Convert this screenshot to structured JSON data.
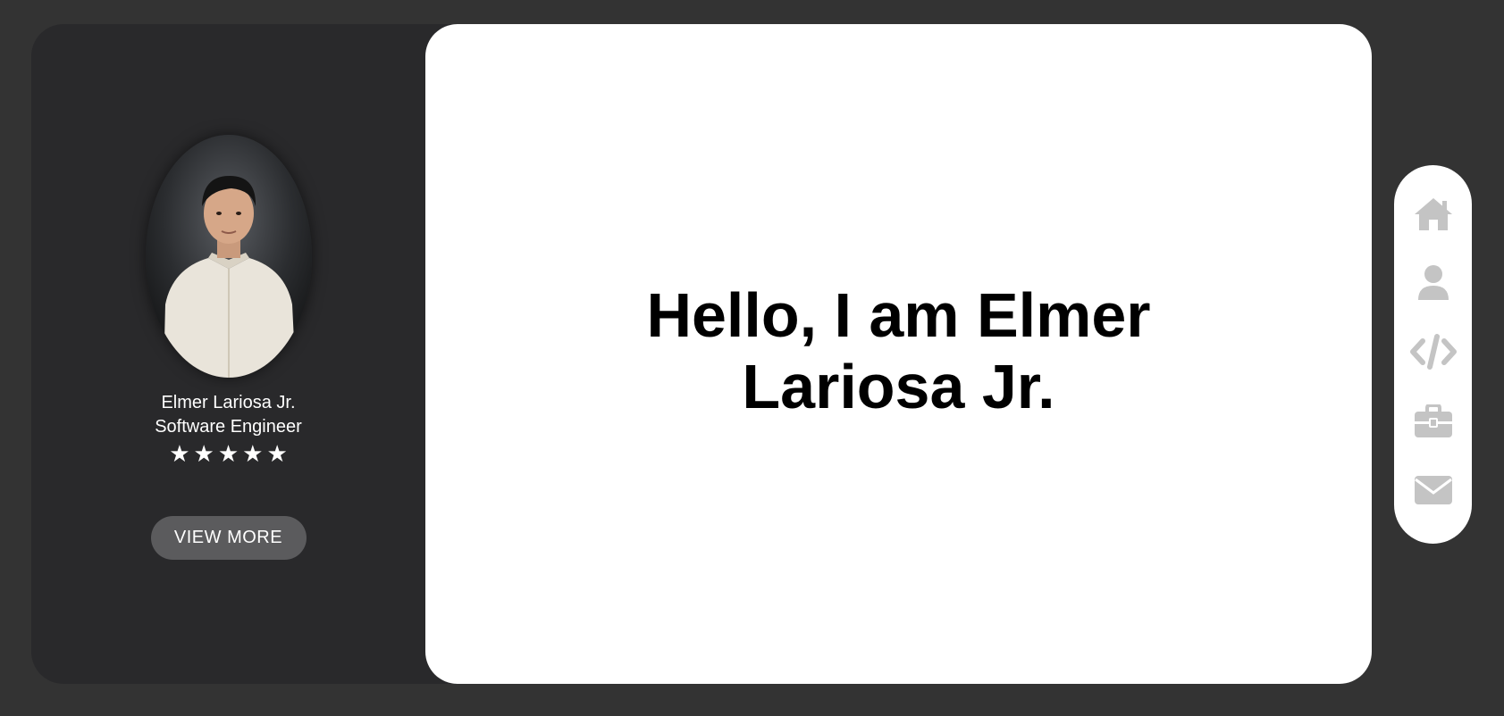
{
  "profile": {
    "name": "Elmer Lariosa Jr.",
    "title": "Software Engineer",
    "rating": 5,
    "stars": [
      "★",
      "★",
      "★",
      "★",
      "★"
    ],
    "button_label": "VIEW MORE"
  },
  "main": {
    "headline": "Hello, I am Elmer Lariosa Jr."
  },
  "nav": {
    "items": [
      {
        "icon": "home-icon"
      },
      {
        "icon": "user-icon"
      },
      {
        "icon": "code-icon"
      },
      {
        "icon": "briefcase-icon"
      },
      {
        "icon": "envelope-icon"
      }
    ]
  },
  "colors": {
    "page_background": "#333333",
    "card_background": "#29292b",
    "button_background": "#5b5b5d",
    "nav_icon": "#c4c4c4"
  }
}
